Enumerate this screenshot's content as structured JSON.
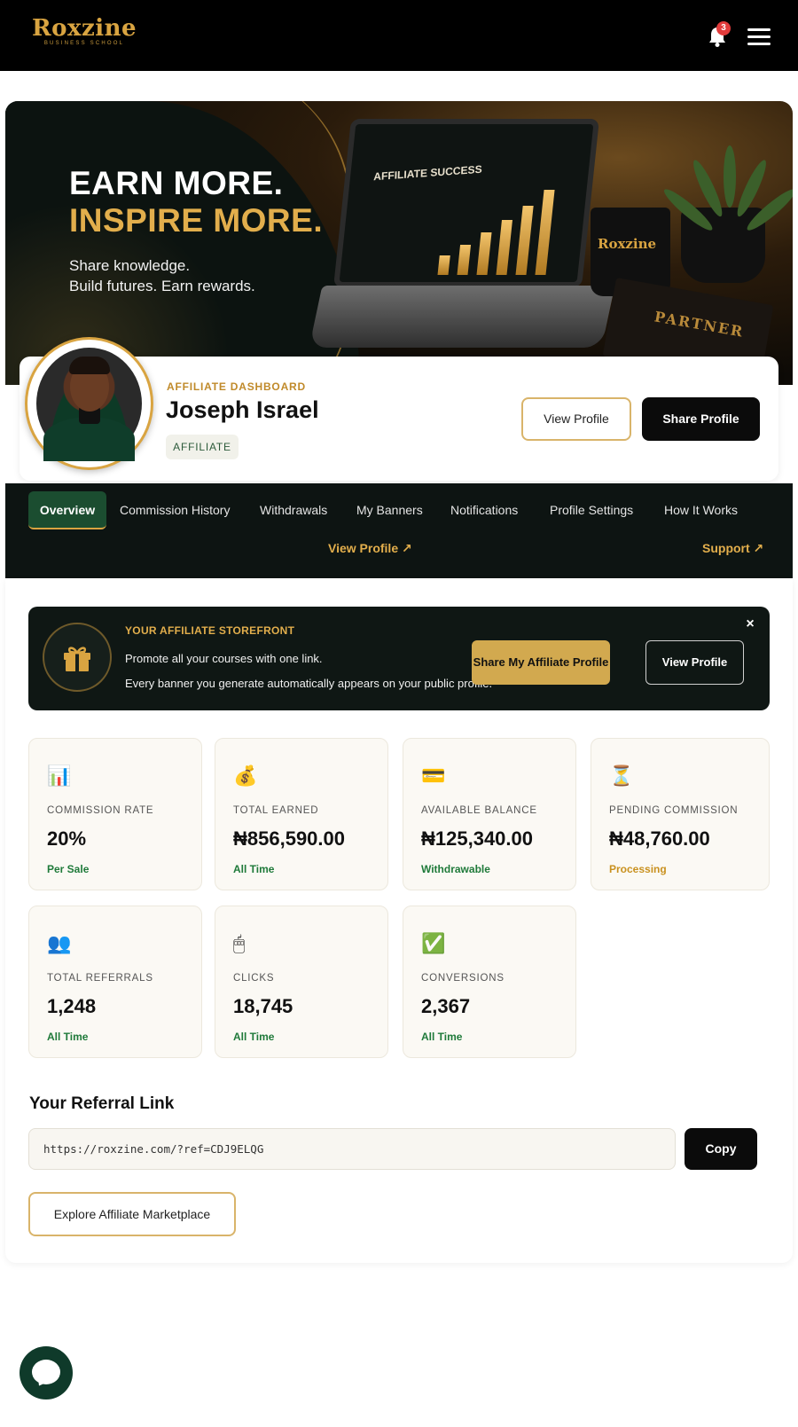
{
  "header": {
    "logo_text": "Roxzine",
    "logo_subtext": "BUSINESS SCHOOL",
    "notification_count": "3",
    "icons": {
      "bell": "bell-icon",
      "menu": "hamburger-menu-icon"
    }
  },
  "hero": {
    "headline_1": "EARN MORE.",
    "headline_2": "INSPIRE MORE.",
    "tagline_1": "Share knowledge.",
    "tagline_2": "Build futures. Earn rewards.",
    "laptop_title": "AFFILIATE SUCCESS",
    "mug_text": "Roxzine",
    "notebook_text": "PARTNER"
  },
  "profile": {
    "section_label": "AFFILIATE DASHBOARD",
    "name": "Joseph Israel",
    "role_badge": "AFFILIATE",
    "view_profile_label": "View Profile",
    "share_profile_label": "Share Profile"
  },
  "nav": {
    "tabs": [
      {
        "label": "Overview",
        "active": true
      },
      {
        "label": "Commission History",
        "active": false
      },
      {
        "label": "Withdrawals",
        "active": false
      },
      {
        "label": "My Banners",
        "active": false
      },
      {
        "label": "Notifications",
        "active": false
      },
      {
        "label": "Profile Settings",
        "active": false
      },
      {
        "label": "How It Works",
        "active": false
      }
    ],
    "view_profile_link": "View Profile ↗",
    "support_link": "Support ↗"
  },
  "storefront": {
    "label": "YOUR AFFILIATE STOREFRONT",
    "line_1": "Promote all your courses with one link.",
    "line_2": "Every banner you generate automatically appears on your public profile.",
    "share_button": "Share My Affiliate Profile",
    "view_button": "View Profile",
    "close_symbol": "×",
    "icon": "gift-icon"
  },
  "stats": [
    {
      "icon": "bar-chart-icon",
      "glyph": "📊",
      "label": "COMMISSION RATE",
      "value": "20%",
      "sub": "Per Sale"
    },
    {
      "icon": "money-bag-icon",
      "glyph": "💰",
      "label": "TOTAL EARNED",
      "value": "₦856,590.00",
      "sub": "All Time"
    },
    {
      "icon": "credit-card-icon",
      "glyph": "💳",
      "label": "AVAILABLE BALANCE",
      "value": "₦125,340.00",
      "sub": "Withdrawable"
    },
    {
      "icon": "hourglass-icon",
      "glyph": "⏳",
      "label": "PENDING COMMISSION",
      "value": "₦48,760.00",
      "sub": "Processing"
    },
    {
      "icon": "users-icon",
      "glyph": "👥",
      "label": "TOTAL REFERRALS",
      "value": "1,248",
      "sub": "All Time"
    },
    {
      "icon": "mouse-icon",
      "glyph": "🖱",
      "label": "CLICKS",
      "value": "18,745",
      "sub": "All Time"
    },
    {
      "icon": "check-icon",
      "glyph": "✅",
      "label": "CONVERSIONS",
      "value": "2,367",
      "sub": "All Time"
    }
  ],
  "referral": {
    "title": "Your Referral Link",
    "link": "https://roxzine.com/?ref=CDJ9ELQG",
    "copy_label": "Copy",
    "marketplace_label": "Explore Affiliate Marketplace"
  },
  "colors": {
    "brand_gold": "#d9a441",
    "dark": "#0b0b0b",
    "active_tab": "#1b4d30",
    "success_green": "#1f7a3a",
    "pending_amber": "#c9911f"
  }
}
